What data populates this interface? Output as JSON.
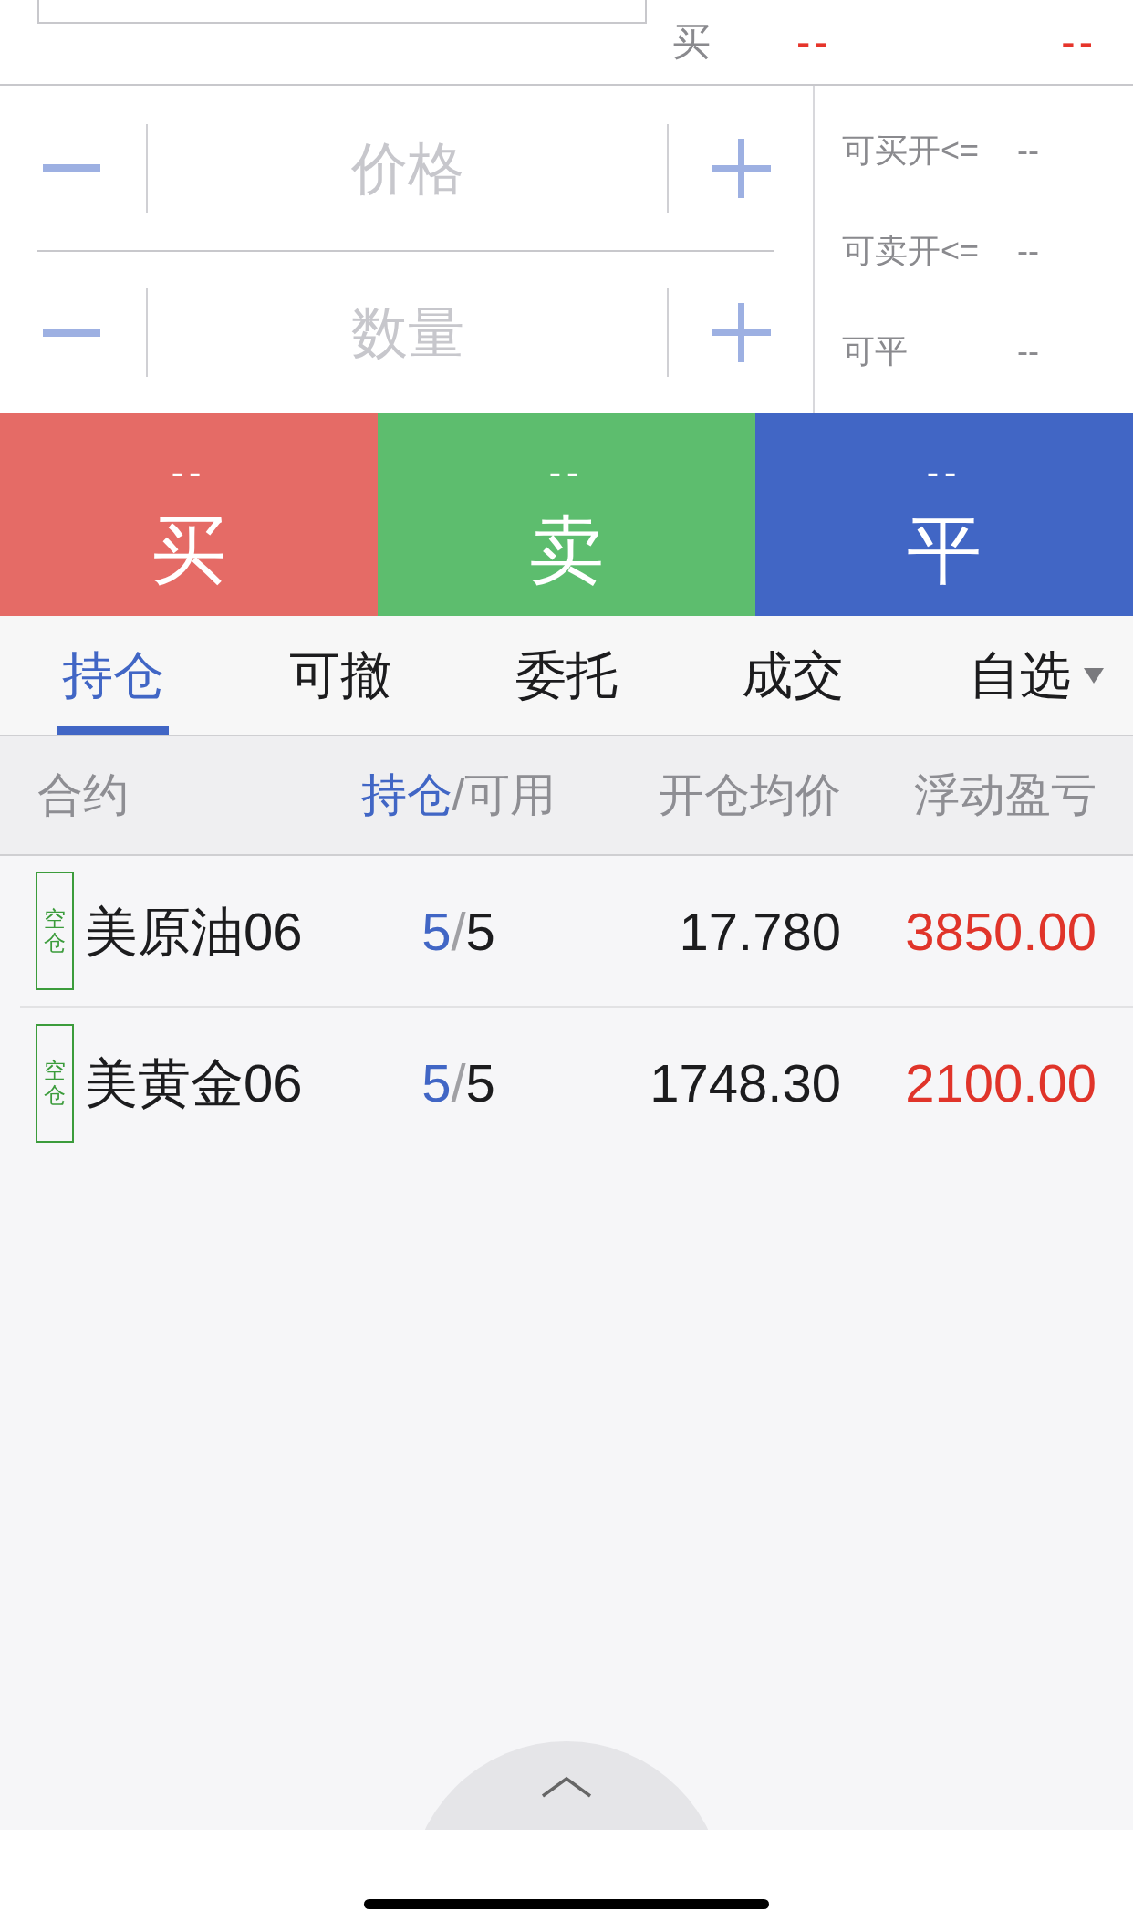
{
  "quote_bar": {
    "label": "买",
    "values": [
      "--",
      "--"
    ]
  },
  "order_inputs": [
    {
      "placeholder": "价格"
    },
    {
      "placeholder": "数量"
    }
  ],
  "limits": [
    {
      "label": "可买开<=",
      "value": "--"
    },
    {
      "label": "可卖开<=",
      "value": "--"
    },
    {
      "label": "可平",
      "value": "--"
    }
  ],
  "actions": [
    {
      "price": "--",
      "label": "买",
      "color": "#e56b66"
    },
    {
      "price": "--",
      "label": "卖",
      "color": "#5dbd6e"
    },
    {
      "price": "--",
      "label": "平",
      "color": "#4166c5"
    }
  ],
  "tabs": [
    {
      "label": "持仓",
      "selected": true,
      "dropdown": false
    },
    {
      "label": "可撤",
      "selected": false,
      "dropdown": false
    },
    {
      "label": "委托",
      "selected": false,
      "dropdown": false
    },
    {
      "label": "成交",
      "selected": false,
      "dropdown": false
    },
    {
      "label": "自选",
      "selected": false,
      "dropdown": true
    }
  ],
  "table": {
    "columns": [
      {
        "kind": "text",
        "label": "合约"
      },
      {
        "kind": "toggle",
        "options": [
          {
            "label": "持仓",
            "selected": true
          },
          {
            "label": "可用",
            "selected": false
          }
        ],
        "separator": "/"
      },
      {
        "kind": "text",
        "label": "开仓均价"
      },
      {
        "kind": "text",
        "label": "浮动盈亏"
      }
    ],
    "rows": [
      {
        "tag": "空仓",
        "name": "美原油06",
        "held": "5",
        "separator": "/",
        "available": "5",
        "avg_price": "17.780",
        "pnl": "3850.00",
        "profit": true
      },
      {
        "tag": "空仓",
        "name": "美黄金06",
        "held": "5",
        "separator": "/",
        "available": "5",
        "avg_price": "1748.30",
        "pnl": "2100.00",
        "profit": true
      }
    ]
  }
}
